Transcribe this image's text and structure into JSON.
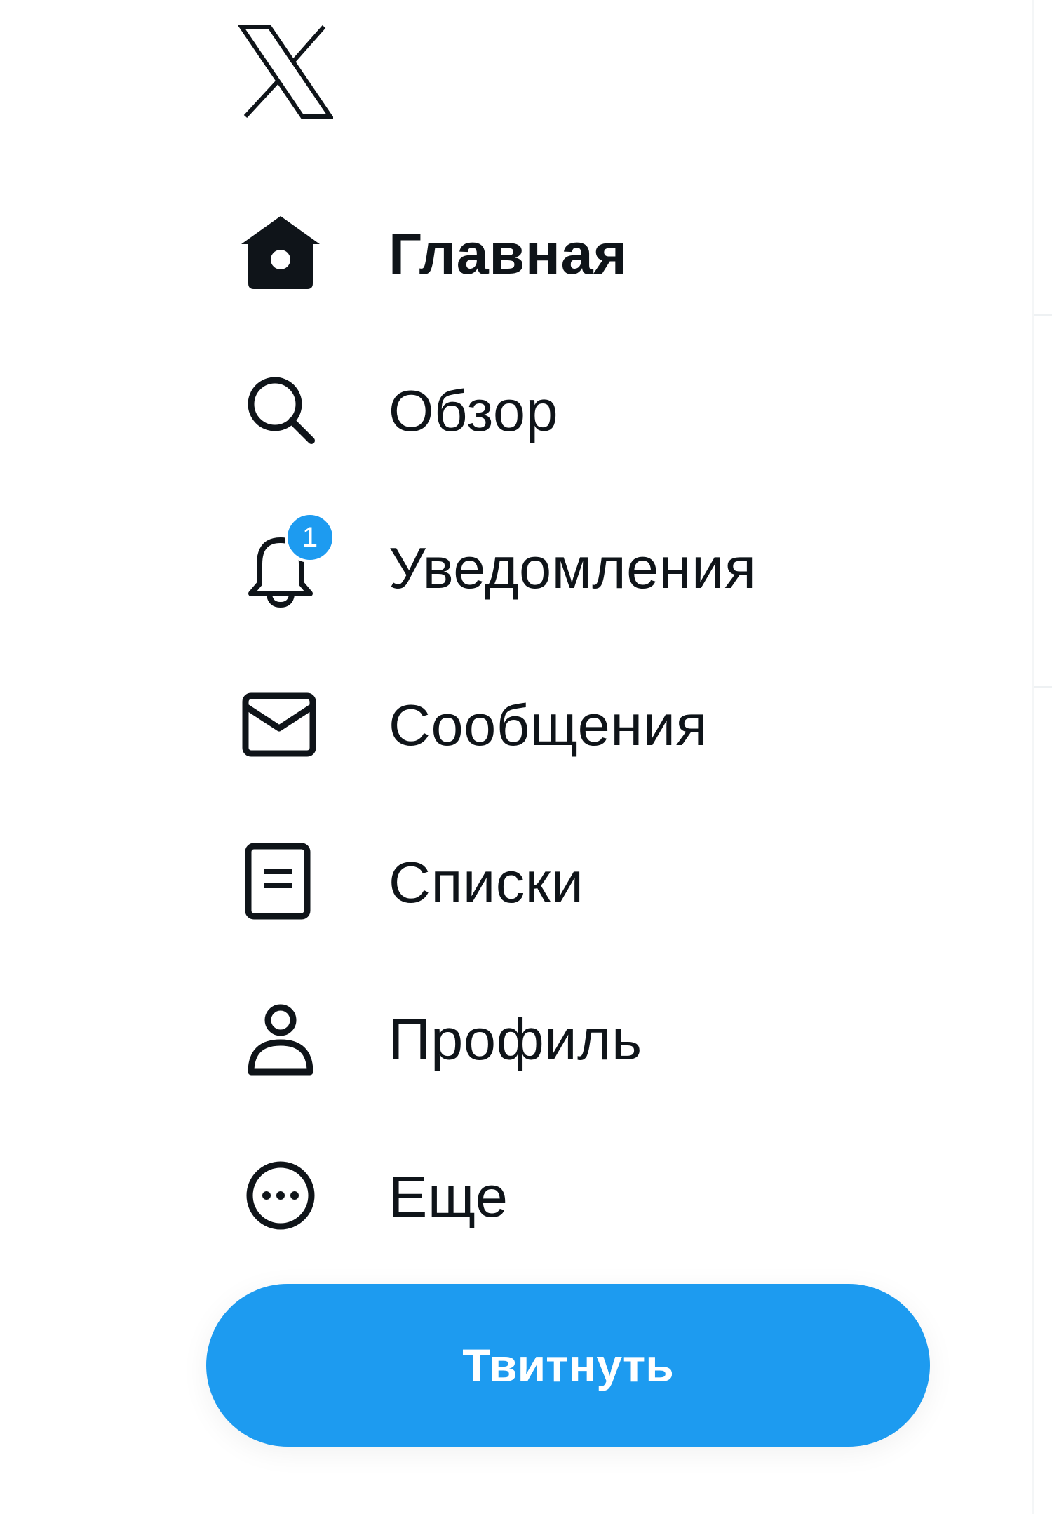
{
  "brand": {
    "logo_icon": "x-logo-icon"
  },
  "nav": {
    "items": [
      {
        "label": "Главная",
        "icon": "home-icon",
        "active": true
      },
      {
        "label": "Обзор",
        "icon": "search-icon",
        "active": false
      },
      {
        "label": "Уведомления",
        "icon": "bell-icon",
        "active": false,
        "badge": "1"
      },
      {
        "label": "Сообщения",
        "icon": "envelope-icon",
        "active": false
      },
      {
        "label": "Списки",
        "icon": "list-icon",
        "active": false
      },
      {
        "label": "Профиль",
        "icon": "person-icon",
        "active": false
      },
      {
        "label": "Еще",
        "icon": "more-circle-icon",
        "active": false
      }
    ]
  },
  "actions": {
    "tweet_label": "Твитнуть"
  },
  "colors": {
    "accent": "#1d9bf0",
    "text": "#0f1419",
    "background": "#ffffff"
  }
}
